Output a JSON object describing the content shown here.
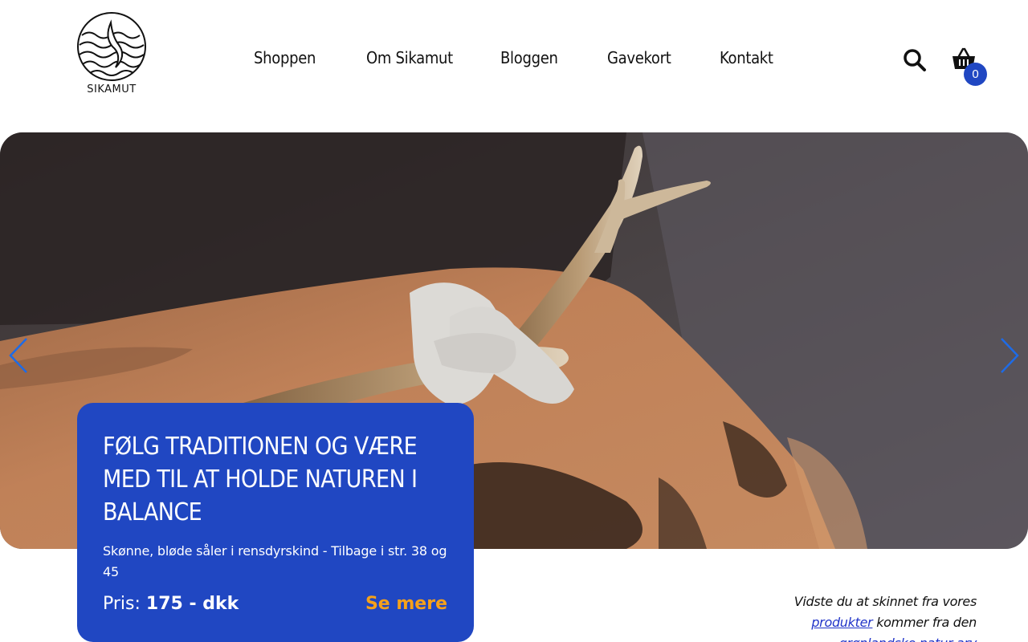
{
  "header": {
    "logo_text": "SIKAMUT",
    "nav": [
      "Shoppen",
      "Om Sikamut",
      "Bloggen",
      "Gavekort",
      "Kontakt"
    ],
    "cart_count": "0"
  },
  "hero": {
    "title": "FØLG TRADITIONEN OG VÆRE MED TIL AT HOLDE NATUREN I BALANCE",
    "subtitle": "Skønne, bløde såler i rensdyrskind - Tilbage i str. 38 og 45",
    "price_label": "Pris:",
    "price_value": "175 - dkk",
    "more_label": "Se mere"
  },
  "aside": {
    "text_1": "Vidste du at skinnet fra vores",
    "link_1": "produkter",
    "text_2": "kommer fra den",
    "link_2": "grønlandske natur arv"
  },
  "colors": {
    "brand_blue": "#2047c2",
    "accent_orange": "#f5a11a",
    "arrow_blue": "#1e6be6"
  },
  "icons": {
    "search": "search-icon",
    "cart": "basket-icon",
    "prev": "chevron-left-icon",
    "next": "chevron-right-icon"
  }
}
